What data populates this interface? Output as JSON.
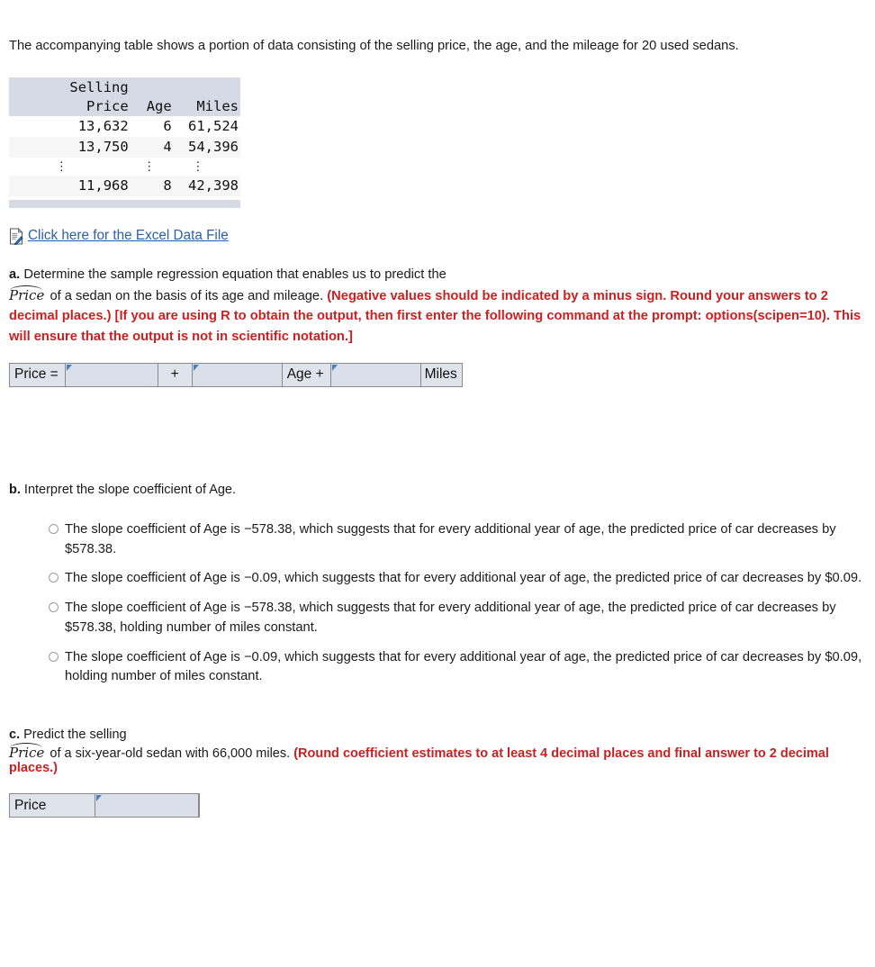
{
  "intro": "The accompanying table shows a portion of data consisting of the selling price, the age, and the mileage for 20 used sedans.",
  "data_table": {
    "headers": {
      "price_line1": "Selling",
      "price_line2": "Price",
      "age": "Age",
      "miles": "Miles"
    },
    "rows": [
      {
        "price": "13,632",
        "age": "6",
        "miles": "61,524"
      },
      {
        "price": "13,750",
        "age": "4",
        "miles": "54,396"
      },
      {
        "price": "⋮",
        "age": "⋮",
        "miles": "⋮"
      },
      {
        "price": "11,968",
        "age": "8",
        "miles": "42,398"
      }
    ]
  },
  "excel": {
    "icon": "excel-file-icon",
    "link_text": "Click here for the Excel Data File"
  },
  "part_a": {
    "label": "a.",
    "line1": "Determine the sample regression equation that enables us to predict the",
    "price_symbol": "Price",
    "line2_plain": "of a sedan on the basis of its age and mileage.",
    "line2_red": "(Negative values should be indicated by a minus sign. Round your answers to 2 decimal places.) [If you are using R to obtain the output, then first enter the following command at the prompt: options(scipen=10). This will ensure that the output is not in scientific notation.]",
    "answer_bar": {
      "price_label": "Price =",
      "plus1": "+",
      "age_label": "Age +",
      "miles_label": "Miles",
      "intercept_value": "",
      "age_coef_value": "",
      "miles_coef_value": "",
      "placeholder": ""
    }
  },
  "part_b": {
    "label": "b.",
    "question": "Interpret the slope coefficient of Age.",
    "options": [
      "The slope coefficient of Age is −578.38, which suggests that for every additional year of age, the predicted price of car decreases by $578.38.",
      "The slope coefficient of Age is −0.09, which suggests that for every additional year of age, the predicted price of car decreases by $0.09.",
      "The slope coefficient of Age is −578.38, which suggests that for every additional year of age, the predicted price of car decreases by $578.38, holding number of miles constant.",
      "The slope coefficient of Age is −0.09, which suggests that for every additional year of age, the predicted price of car decreases by $0.09, holding number of miles constant."
    ],
    "selected_index": -1
  },
  "part_c": {
    "label": "c.",
    "line1": "Predict the selling",
    "price_symbol": "Price",
    "line2_plain": "of a six-year-old sedan with 66,000 miles.",
    "line2_red": "(Round coefficient estimates to at least 4 decimal places and final answer to 2 decimal places.)",
    "answer_bar": {
      "price_label": "Price",
      "value": "",
      "placeholder": ""
    }
  },
  "colors": {
    "link": "#2b5fa8",
    "red_instruction": "#cc1f1f",
    "table_header_bg": "#d5dae4",
    "input_bg": "#dbdfe9",
    "input_border": "#8a8a8a",
    "cursor_marker": "#4a7ebb"
  }
}
